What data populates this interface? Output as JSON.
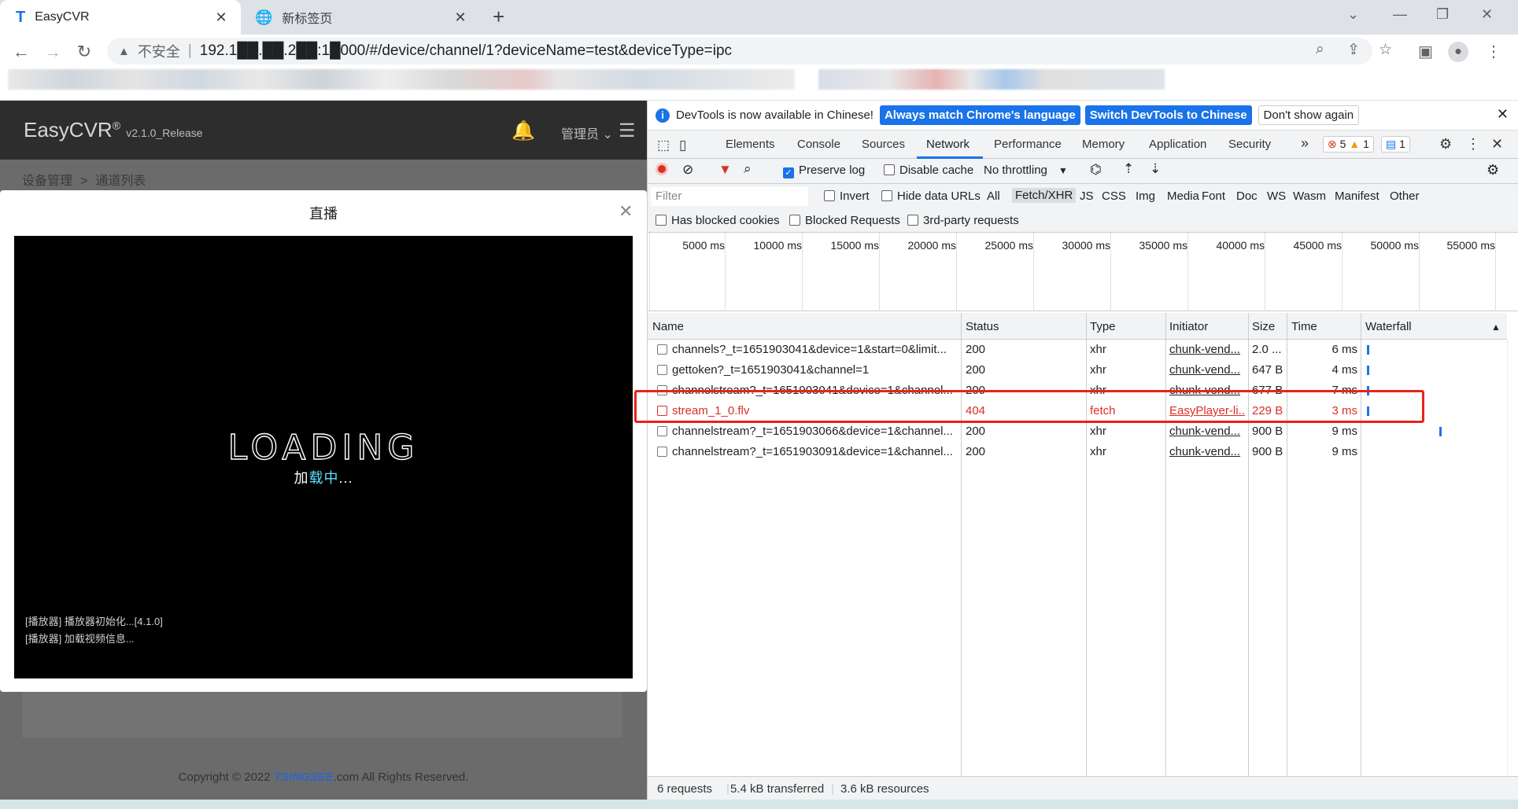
{
  "browser": {
    "tabs": [
      {
        "title": "EasyCVR",
        "icon": "easycvr-logo-icon",
        "close": "✕"
      },
      {
        "title": "新标签页",
        "icon": "globe-icon",
        "close": "✕"
      }
    ],
    "new_tab": "+",
    "address": {
      "security_label": "不安全",
      "url": "192.1██.██.2██:1█000/#/device/channel/1?deviceName=test&deviceType=ipc"
    }
  },
  "app": {
    "brand": "EasyCVR",
    "brand_mark": "®",
    "version": "v2.1.0_Release",
    "user": "管理员",
    "breadcrumb": [
      "设备管理",
      "通道列表"
    ],
    "breadcrumb_sep": ">",
    "copyright_prefix": "Copyright © 2022 ",
    "copyright_brand": "TSINGSEE",
    "copyright_suffix": ".com All Rights Reserved."
  },
  "modal": {
    "title": "直播",
    "loading_text": "LOADING",
    "loading_sub_1": "加",
    "loading_sub_2": "载中",
    "loading_sub_3": "...",
    "logs": [
      "[播放器] 播放器初始化...[4.1.0]",
      "[播放器] 加载视频信息..."
    ]
  },
  "devtools": {
    "info": {
      "message": "DevTools is now available in Chinese!",
      "btn_match": "Always match Chrome's language",
      "btn_switch": "Switch DevTools to Chinese",
      "btn_dismiss": "Don't show again"
    },
    "tabs": [
      "Elements",
      "Console",
      "Sources",
      "Network",
      "Performance",
      "Memory",
      "Application",
      "Security"
    ],
    "more": "»",
    "badges": {
      "errors": "5",
      "warnings": "1",
      "messages": "1"
    },
    "network_toolbar": {
      "preserve_log": "Preserve log",
      "disable_cache": "Disable cache",
      "throttling": "No throttling"
    },
    "filter": {
      "placeholder": "Filter",
      "invert": "Invert",
      "hide_data_urls": "Hide data URLs",
      "types": [
        "All",
        "Fetch/XHR",
        "JS",
        "CSS",
        "Img",
        "Media",
        "Font",
        "Doc",
        "WS",
        "Wasm",
        "Manifest",
        "Other"
      ],
      "selected_type": "Fetch/XHR",
      "has_blocked_cookies": "Has blocked cookies",
      "blocked_requests": "Blocked Requests",
      "third_party": "3rd-party requests"
    },
    "timeline_ticks": [
      "5000 ms",
      "10000 ms",
      "15000 ms",
      "20000 ms",
      "25000 ms",
      "30000 ms",
      "35000 ms",
      "40000 ms",
      "45000 ms",
      "50000 ms",
      "55000 ms"
    ],
    "columns": [
      "Name",
      "Status",
      "Type",
      "Initiator",
      "Size",
      "Time",
      "Waterfall"
    ],
    "sort_indicator": "▲",
    "requests": [
      {
        "name": "channels?_t=1651903041&device=1&start=0&limit...",
        "status": "200",
        "type": "xhr",
        "initiator": "chunk-vend...",
        "size": "2.0 ...",
        "time": "6 ms"
      },
      {
        "name": "gettoken?_t=1651903041&channel=1",
        "status": "200",
        "type": "xhr",
        "initiator": "chunk-vend...",
        "size": "647 B",
        "time": "4 ms"
      },
      {
        "name": "channelstream?_t=1651903041&device=1&channel...",
        "status": "200",
        "type": "xhr",
        "initiator": "chunk-vend...",
        "size": "677 B",
        "time": "7 ms"
      },
      {
        "name": "stream_1_0.flv",
        "status": "404",
        "type": "fetch",
        "initiator": "EasyPlayer-li...",
        "size": "229 B",
        "time": "3 ms"
      },
      {
        "name": "channelstream?_t=1651903066&device=1&channel...",
        "status": "200",
        "type": "xhr",
        "initiator": "chunk-vend...",
        "size": "900 B",
        "time": "9 ms"
      },
      {
        "name": "channelstream?_t=1651903091&device=1&channel...",
        "status": "200",
        "type": "xhr",
        "initiator": "chunk-vend...",
        "size": "900 B",
        "time": "9 ms"
      }
    ],
    "status_bar": [
      "6 requests",
      "5.4 kB transferred",
      "3.6 kB resources"
    ],
    "colors": {
      "accent": "#1a73e8",
      "error": "#d93025",
      "highlight": "#e8231c"
    }
  }
}
